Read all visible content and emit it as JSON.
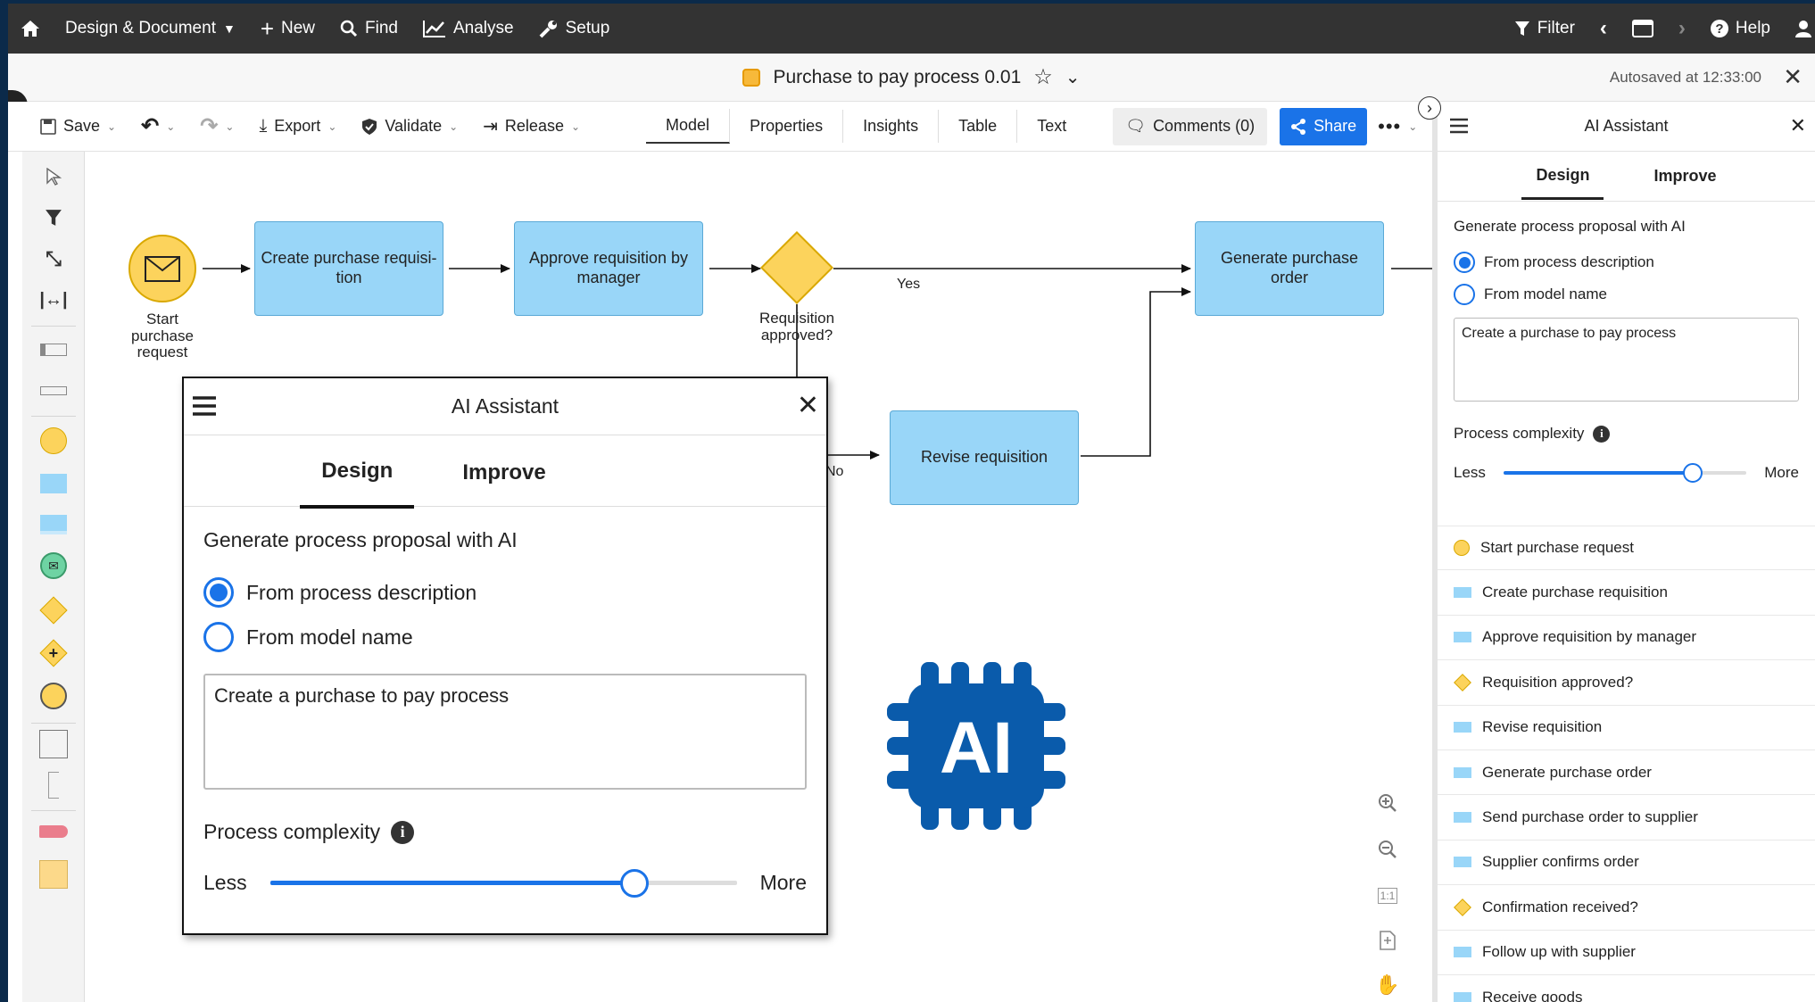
{
  "topbar": {
    "home_icon": "home-icon",
    "menu": [
      {
        "label": "Design & Document",
        "icon": ""
      },
      {
        "label": "New",
        "icon": "plus-icon"
      },
      {
        "label": "Find",
        "icon": "search-icon"
      },
      {
        "label": "Analyse",
        "icon": "chart-icon"
      },
      {
        "label": "Setup",
        "icon": "wrench-icon"
      }
    ],
    "filter_label": "Filter",
    "help_label": "Help"
  },
  "titlebar": {
    "document_title": "Purchase to pay process 0.01",
    "autosave_text": "Autosaved at 12:33:00"
  },
  "toolbar": {
    "save_label": "Save",
    "export_label": "Export",
    "validate_label": "Validate",
    "release_label": "Release",
    "tabs": [
      "Model",
      "Properties",
      "Insights",
      "Table",
      "Text"
    ],
    "active_tab": "Model",
    "comments_label": "Comments (0)",
    "share_label": "Share"
  },
  "diagram": {
    "start_event_label": "Start purchase request",
    "start_event_lines": [
      "Start",
      "purchase",
      "request"
    ],
    "task_create": "Create purchase requisi-tion",
    "task_create_lines": [
      "Create purchase requisi-",
      "tion"
    ],
    "task_approve_lines": [
      "Approve requisition by",
      "manager"
    ],
    "gateway_lines": [
      "Requisition",
      "approved?"
    ],
    "edge_yes": "Yes",
    "edge_no": "No",
    "task_generate": "Generate purchase order",
    "task_revise": "Revise requisition",
    "ai_badge_text": "AI"
  },
  "ai_assistant": {
    "title": "AI Assistant",
    "tabs": [
      "Design",
      "Improve"
    ],
    "active_tab": "Design",
    "section_heading": "Generate process proposal with AI",
    "option_description": "From process description",
    "option_model_name": "From model name",
    "selected_option": "From process description",
    "prompt_text": "Create a purchase to pay process",
    "complexity_label": "Process complexity",
    "slider_less": "Less",
    "slider_more": "More",
    "complexity_value": 0.78
  },
  "element_list": [
    {
      "label": "Start purchase request",
      "shape": "circle"
    },
    {
      "label": "Create purchase requisition",
      "shape": "rect"
    },
    {
      "label": "Approve requisition by manager",
      "shape": "rect"
    },
    {
      "label": "Requisition approved?",
      "shape": "diamond"
    },
    {
      "label": "Revise requisition",
      "shape": "rect"
    },
    {
      "label": "Generate purchase order",
      "shape": "rect"
    },
    {
      "label": "Send purchase order to supplier",
      "shape": "rect"
    },
    {
      "label": "Supplier confirms order",
      "shape": "rect"
    },
    {
      "label": "Confirmation received?",
      "shape": "diamond"
    },
    {
      "label": "Follow up with supplier",
      "shape": "rect"
    },
    {
      "label": "Receive goods",
      "shape": "rect"
    }
  ],
  "colors": {
    "accent": "#1a73e8",
    "task_fill": "#99d6f8",
    "event_fill": "#fcd35c",
    "ai_badge": "#0a5bab"
  }
}
